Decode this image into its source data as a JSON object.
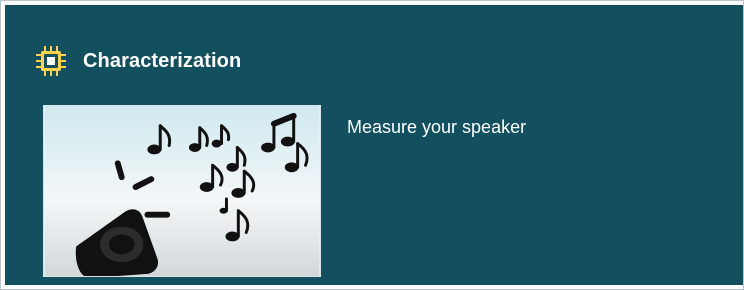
{
  "panel": {
    "title": "Characterization",
    "title_icon": "chip-icon",
    "items": [
      {
        "thumbnail_icon": "speaker-music-notes-icon",
        "description": "Measure your speaker"
      }
    ]
  },
  "colors": {
    "panel_background": "#12505f",
    "text": "#ffffff",
    "accent_icon": "#ffd24a"
  }
}
